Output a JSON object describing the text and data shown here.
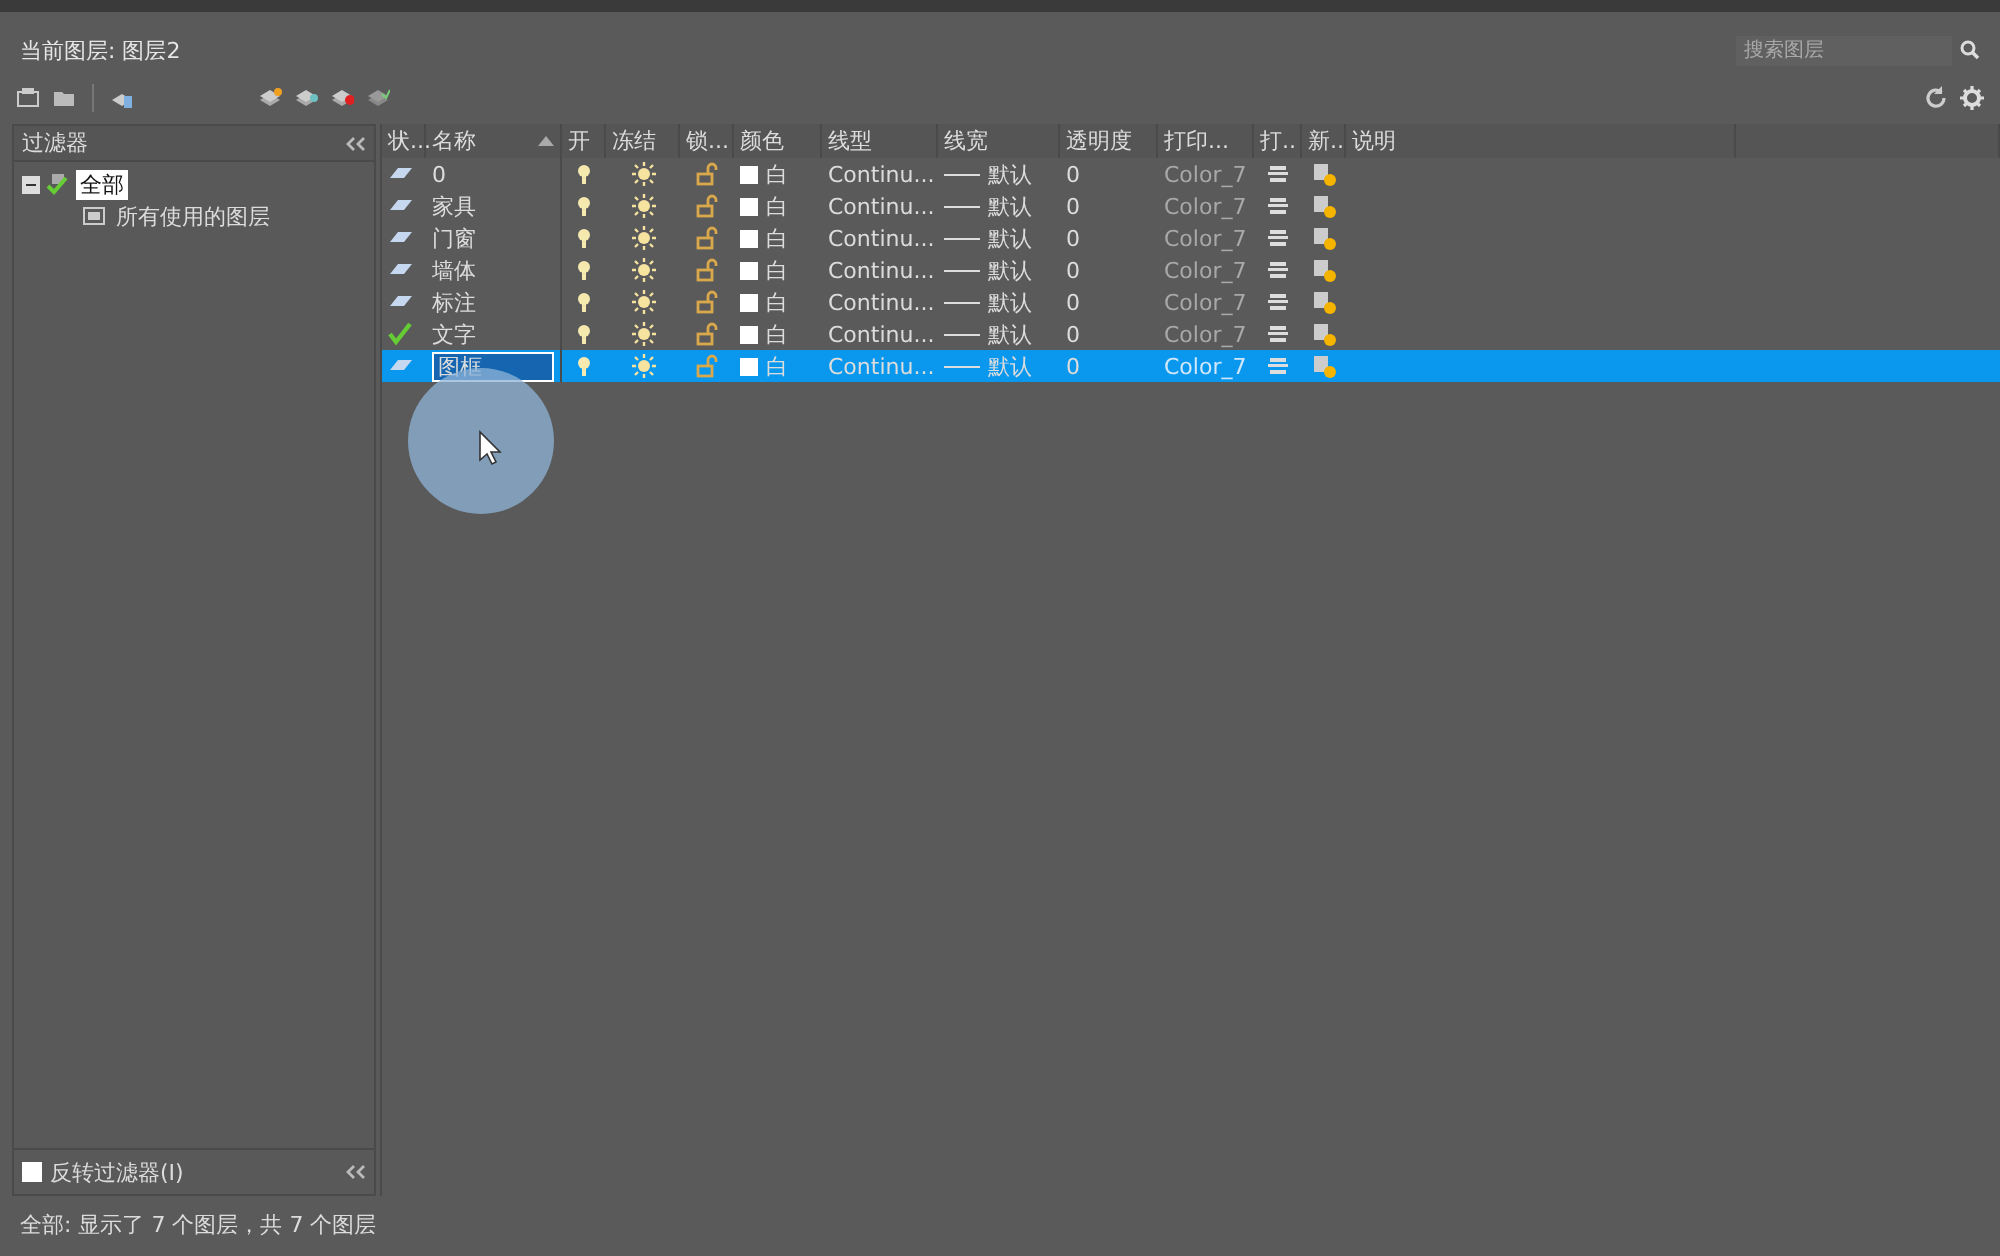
{
  "header": {
    "current_layer": "当前图层: 图层2",
    "search": {
      "placeholder": "搜索图层"
    }
  },
  "filters": {
    "title": "过滤器",
    "tree": [
      {
        "label": "全部",
        "selected": true,
        "expanded": true,
        "children": [
          {
            "label": "所有使用的图层",
            "selected": false
          }
        ]
      }
    ],
    "invert": {
      "label": "反转过滤器(I)",
      "checked": false
    }
  },
  "table": {
    "columns": [
      "状...",
      "名称",
      "开",
      "冻结",
      "锁...",
      "颜色",
      "线型",
      "线宽",
      "透明度",
      "打印...",
      "打..",
      "新..",
      "说明"
    ],
    "rows": [
      {
        "current": false,
        "name": "0",
        "on": true,
        "frozen": false,
        "locked": false,
        "color_name": "白",
        "linetype": "Continu...",
        "lineweight": "默认",
        "transparency": "0",
        "plot_style": "Color_7",
        "selected": false
      },
      {
        "current": false,
        "name": "家具",
        "on": true,
        "frozen": false,
        "locked": false,
        "color_name": "白",
        "linetype": "Continu...",
        "lineweight": "默认",
        "transparency": "0",
        "plot_style": "Color_7",
        "selected": false
      },
      {
        "current": false,
        "name": "门窗",
        "on": true,
        "frozen": false,
        "locked": false,
        "color_name": "白",
        "linetype": "Continu...",
        "lineweight": "默认",
        "transparency": "0",
        "plot_style": "Color_7",
        "selected": false
      },
      {
        "current": false,
        "name": "墙体",
        "on": true,
        "frozen": false,
        "locked": false,
        "color_name": "白",
        "linetype": "Continu...",
        "lineweight": "默认",
        "transparency": "0",
        "plot_style": "Color_7",
        "selected": false
      },
      {
        "current": false,
        "name": "标注",
        "on": true,
        "frozen": false,
        "locked": false,
        "color_name": "白",
        "linetype": "Continu...",
        "lineweight": "默认",
        "transparency": "0",
        "plot_style": "Color_7",
        "selected": false
      },
      {
        "current": true,
        "name": "文字",
        "on": true,
        "frozen": false,
        "locked": false,
        "color_name": "白",
        "linetype": "Continu...",
        "lineweight": "默认",
        "transparency": "0",
        "plot_style": "Color_7",
        "selected": false
      },
      {
        "current": false,
        "name": "图框",
        "on": true,
        "frozen": false,
        "locked": false,
        "color_name": "白",
        "linetype": "Continu...",
        "lineweight": "默认",
        "transparency": "0",
        "plot_style": "Color_7",
        "selected": true
      }
    ]
  },
  "status_bar": "全部: 显示了 7 个图层，共 7 个图层"
}
